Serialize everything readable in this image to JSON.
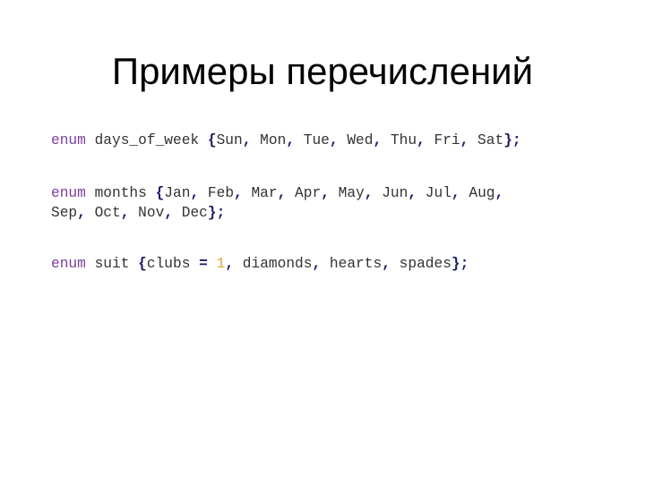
{
  "slide": {
    "title": "Примеры перечислений"
  },
  "colors": {
    "keyword": "#7b3f9e",
    "punctuation": "#1a1a66",
    "number": "#e6a23c",
    "identifier": "#333333",
    "title": "#000000",
    "background": "#ffffff"
  },
  "code": [
    {
      "keyword": "enum",
      "name": "days_of_week",
      "values": [
        "Sun",
        "Mon",
        "Tue",
        "Wed",
        "Thu",
        "Fri",
        "Sat"
      ],
      "lines": [
        [
          {
            "t": "kw",
            "v": "enum"
          },
          {
            "t": "id",
            "v": " days_of_week "
          },
          {
            "t": "pn",
            "v": "{"
          },
          {
            "t": "id",
            "v": "Sun"
          },
          {
            "t": "pn",
            "v": ","
          },
          {
            "t": "id",
            "v": " Mon"
          },
          {
            "t": "pn",
            "v": ","
          },
          {
            "t": "id",
            "v": " Tue"
          },
          {
            "t": "pn",
            "v": ","
          },
          {
            "t": "id",
            "v": " Wed"
          },
          {
            "t": "pn",
            "v": ","
          },
          {
            "t": "id",
            "v": " Thu"
          },
          {
            "t": "pn",
            "v": ","
          },
          {
            "t": "id",
            "v": " Fri"
          },
          {
            "t": "pn",
            "v": ","
          },
          {
            "t": "id",
            "v": " Sat"
          },
          {
            "t": "pn",
            "v": "};"
          }
        ]
      ]
    },
    {
      "keyword": "enum",
      "name": "months",
      "values": [
        "Jan",
        "Feb",
        "Mar",
        "Apr",
        "May",
        "Jun",
        "Jul",
        "Aug",
        "Sep",
        "Oct",
        "Nov",
        "Dec"
      ],
      "lines": [
        [
          {
            "t": "kw",
            "v": "enum"
          },
          {
            "t": "id",
            "v": " months "
          },
          {
            "t": "pn",
            "v": "{"
          },
          {
            "t": "id",
            "v": "Jan"
          },
          {
            "t": "pn",
            "v": ","
          },
          {
            "t": "id",
            "v": " Feb"
          },
          {
            "t": "pn",
            "v": ","
          },
          {
            "t": "id",
            "v": " Mar"
          },
          {
            "t": "pn",
            "v": ","
          },
          {
            "t": "id",
            "v": " Apr"
          },
          {
            "t": "pn",
            "v": ","
          },
          {
            "t": "id",
            "v": " May"
          },
          {
            "t": "pn",
            "v": ","
          },
          {
            "t": "id",
            "v": " Jun"
          },
          {
            "t": "pn",
            "v": ","
          },
          {
            "t": "id",
            "v": " Jul"
          },
          {
            "t": "pn",
            "v": ","
          },
          {
            "t": "id",
            "v": " Aug"
          },
          {
            "t": "pn",
            "v": ","
          }
        ],
        [
          {
            "t": "id",
            "v": "Sep"
          },
          {
            "t": "pn",
            "v": ","
          },
          {
            "t": "id",
            "v": " Oct"
          },
          {
            "t": "pn",
            "v": ","
          },
          {
            "t": "id",
            "v": " Nov"
          },
          {
            "t": "pn",
            "v": ","
          },
          {
            "t": "id",
            "v": " Dec"
          },
          {
            "t": "pn",
            "v": "};"
          }
        ]
      ]
    },
    {
      "keyword": "enum",
      "name": "suit",
      "values": [
        "clubs = 1",
        "diamonds",
        "hearts",
        "spades"
      ],
      "lines": [
        [
          {
            "t": "kw",
            "v": "enum"
          },
          {
            "t": "id",
            "v": " suit "
          },
          {
            "t": "pn",
            "v": "{"
          },
          {
            "t": "id",
            "v": "clubs "
          },
          {
            "t": "pn",
            "v": "="
          },
          {
            "t": "id",
            "v": " "
          },
          {
            "t": "num",
            "v": "1"
          },
          {
            "t": "pn",
            "v": ","
          },
          {
            "t": "id",
            "v": " diamonds"
          },
          {
            "t": "pn",
            "v": ","
          },
          {
            "t": "id",
            "v": " hearts"
          },
          {
            "t": "pn",
            "v": ","
          },
          {
            "t": "id",
            "v": " spades"
          },
          {
            "t": "pn",
            "v": "};"
          }
        ]
      ]
    }
  ]
}
